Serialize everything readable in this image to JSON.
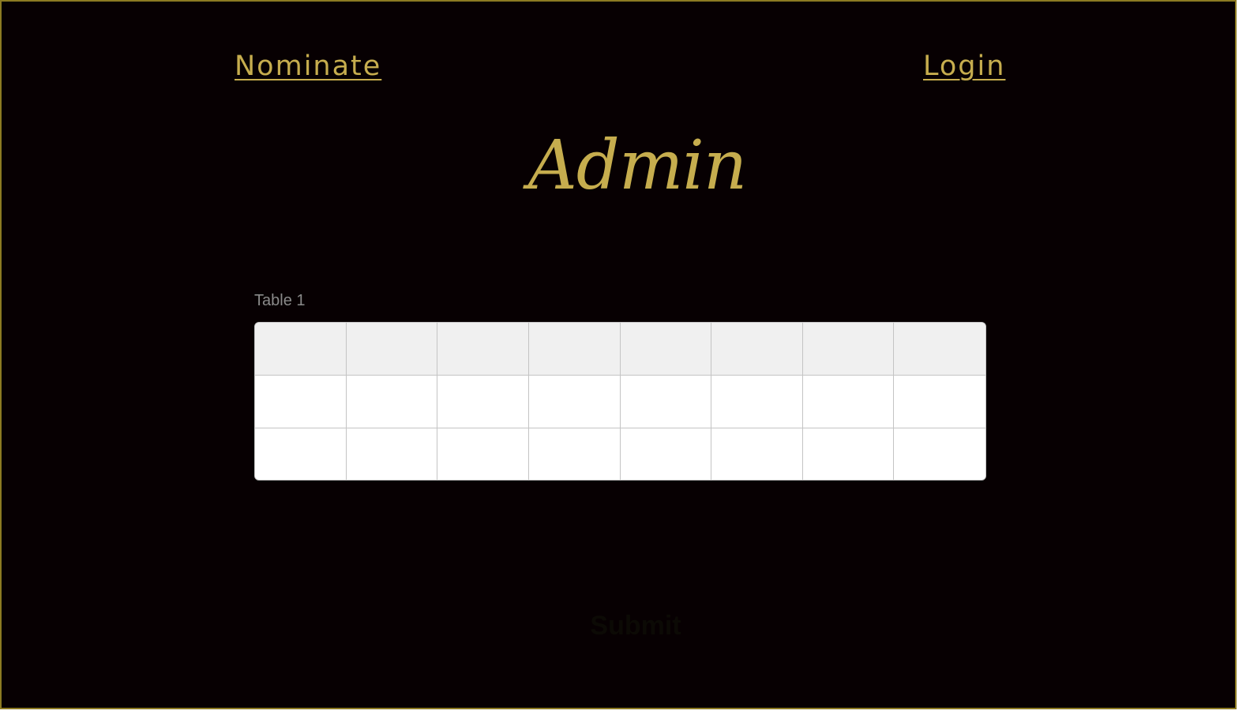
{
  "nav": {
    "nominate_label": "Nominate",
    "login_label": "Login"
  },
  "page": {
    "title": "Admin"
  },
  "table": {
    "caption": "Table 1",
    "columns": 8,
    "rows": [
      [
        "",
        "",
        "",
        "",
        "",
        "",
        "",
        ""
      ],
      [
        "",
        "",
        "",
        "",
        "",
        "",
        "",
        ""
      ],
      [
        "",
        "",
        "",
        "",
        "",
        "",
        "",
        ""
      ]
    ]
  },
  "form": {
    "submit_label": "Submit"
  },
  "colors": {
    "background": "#070002",
    "accent_gold": "#c6ad4e",
    "frame_border": "#8c7a22",
    "table_header_bg": "#f0f0f0",
    "table_border": "#c4c4c4"
  }
}
